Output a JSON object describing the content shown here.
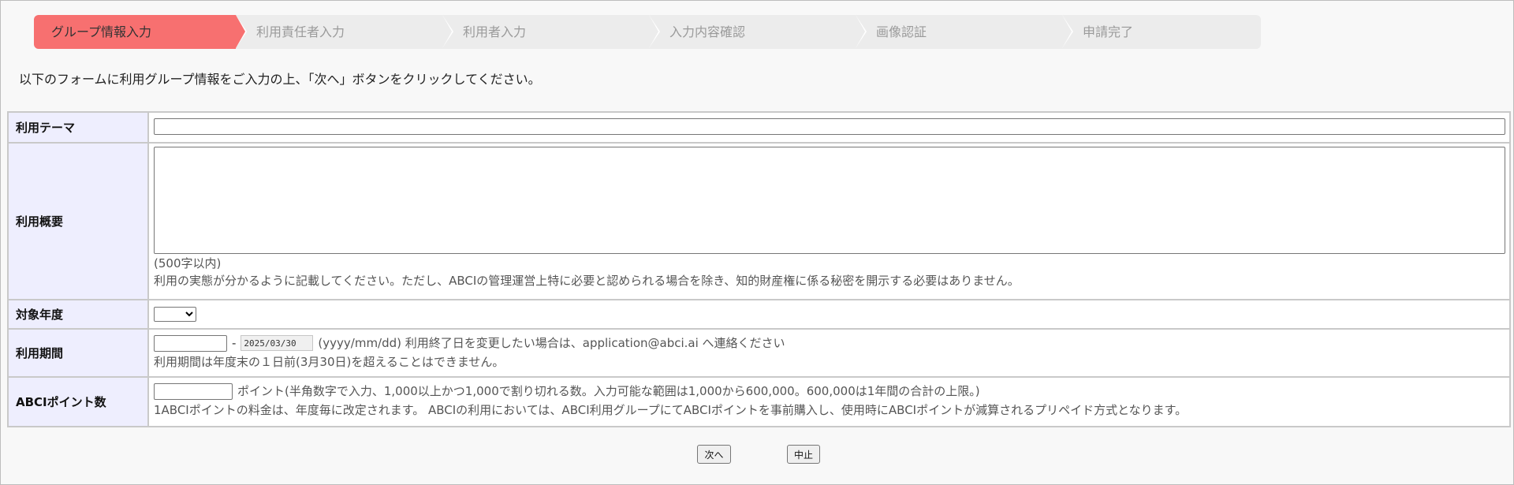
{
  "steps": [
    {
      "label": "グループ情報入力",
      "active": true
    },
    {
      "label": "利用責任者入力",
      "active": false
    },
    {
      "label": "利用者入力",
      "active": false
    },
    {
      "label": "入力内容確認",
      "active": false
    },
    {
      "label": "画像認証",
      "active": false
    },
    {
      "label": "申請完了",
      "active": false
    }
  ],
  "instruction": "以下のフォームに利用グループ情報をご入力の上、「次へ」ボタンをクリックしてください。",
  "form": {
    "theme": {
      "label": "利用テーマ",
      "value": ""
    },
    "summary": {
      "label": "利用概要",
      "value": "",
      "limit_note": "(500字以内)",
      "help": "利用の実態が分かるように記載してください。ただし、ABCIの管理運営上特に必要と認められる場合を除き、知的財産権に係る秘密を開示する必要はありません。"
    },
    "year": {
      "label": "対象年度",
      "selected": ""
    },
    "period": {
      "label": "利用期間",
      "from_value": "",
      "to_value": "2025/03/30",
      "format_note": "(yyyy/mm/dd) 利用終了日を変更したい場合は、application@abci.ai へ連絡ください",
      "help": "利用期間は年度末の１日前(3月30日)を超えることはできません。"
    },
    "points": {
      "label": "ABCIポイント数",
      "value": "",
      "unit_note": "ポイント(半角数字で入力、1,000以上かつ1,000で割り切れる数。入力可能な範囲は1,000から600,000。600,000は1年間の合計の上限。)",
      "help": "1ABCIポイントの料金は、年度毎に改定されます。 ABCIの利用においては、ABCI利用グループにてABCIポイントを事前購入し、使用時にABCIポイントが減算されるプリペイド方式となります。"
    }
  },
  "buttons": {
    "next": "次へ",
    "cancel": "中止"
  },
  "colors": {
    "active_step": "#f77070",
    "label_bg": "#eeeefe",
    "steps_bg": "#ececec"
  }
}
